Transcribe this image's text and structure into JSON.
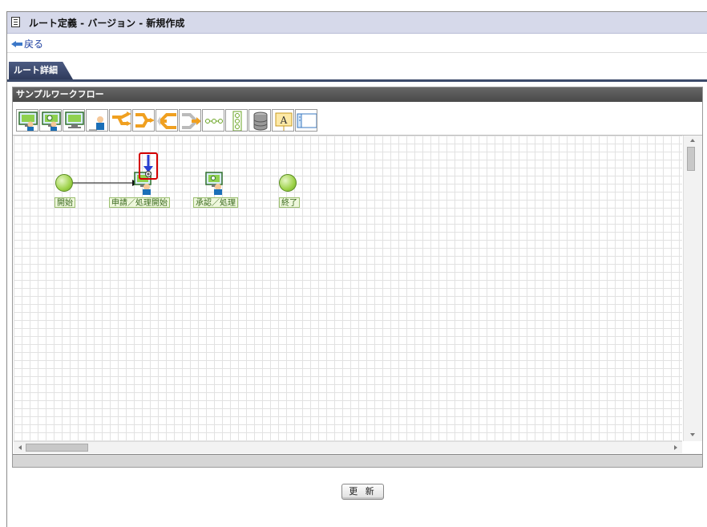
{
  "window": {
    "title": "ルート定義 - バージョン - 新規作成"
  },
  "nav": {
    "back_label": "戻る"
  },
  "tabs": [
    {
      "label": "ルート詳細"
    }
  ],
  "panel": {
    "title": "サンプルワークフロー"
  },
  "toolbar": {
    "buttons": [
      {
        "icon": "task-node-icon"
      },
      {
        "icon": "approval-task-icon"
      },
      {
        "icon": "process-task-icon"
      },
      {
        "icon": "user-task-icon"
      },
      {
        "icon": "branch-split-icon"
      },
      {
        "icon": "branch-join-icon"
      },
      {
        "icon": "parallel-split-icon"
      },
      {
        "icon": "parallel-join-icon"
      },
      {
        "icon": "connector-line-icon"
      },
      {
        "icon": "vertical-chain-icon"
      },
      {
        "icon": "database-icon"
      },
      {
        "icon": "text-label-icon"
      },
      {
        "icon": "frame-container-icon"
      }
    ]
  },
  "nodes": [
    {
      "id": "start",
      "label": "開始",
      "type": "start"
    },
    {
      "id": "apply",
      "label": "申請／処理開始",
      "type": "task"
    },
    {
      "id": "approve",
      "label": "承認／処理",
      "type": "task"
    },
    {
      "id": "end",
      "label": "終了",
      "type": "end"
    }
  ],
  "footer": {
    "update_label": "更 新"
  },
  "colors": {
    "tab": "#3c4a6a",
    "title_bar": "#d6d9ea",
    "node_green": "#9ed24a",
    "highlight_red": "#d40000",
    "arrow_blue": "#2a3fd0"
  }
}
